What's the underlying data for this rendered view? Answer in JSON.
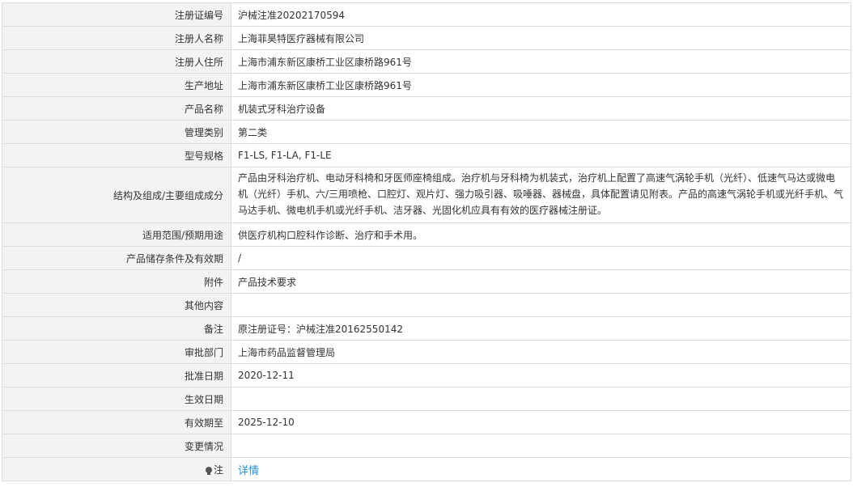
{
  "rows": [
    {
      "label": "注册证编号",
      "value": "沪械注准20202170594"
    },
    {
      "label": "注册人名称",
      "value": "上海菲昊特医疗器械有限公司"
    },
    {
      "label": "注册人住所",
      "value": "上海市浦东新区康桥工业区康桥路961号"
    },
    {
      "label": "生产地址",
      "value": "上海市浦东新区康桥工业区康桥路961号"
    },
    {
      "label": "产品名称",
      "value": "机装式牙科治疗设备"
    },
    {
      "label": "管理类别",
      "value": "第二类"
    },
    {
      "label": "型号规格",
      "value": "F1-LS, F1-LA, F1-LE"
    },
    {
      "label": "结构及组成/主要组成成分",
      "value": "产品由牙科治疗机、电动牙科椅和牙医师座椅组成。治疗机与牙科椅为机装式，治疗机上配置了高速气涡轮手机（光纤）、低速气马达或微电机（光纤）手机、六/三用喷枪、口腔灯、观片灯、强力吸引器、吸唾器、器械盘，具体配置请见附表。产品的高速气涡轮手机或光纤手机、气马达手机、微电机手机或光纤手机、洁牙器、光固化机应具有有效的医疗器械注册证。"
    },
    {
      "label": "适用范围/预期用途",
      "value": "供医疗机构口腔科作诊断、治疗和手术用。"
    },
    {
      "label": "产品储存条件及有效期",
      "value": "/"
    },
    {
      "label": "附件",
      "value": "产品技术要求"
    },
    {
      "label": "其他内容",
      "value": ""
    },
    {
      "label": "备注",
      "value": "原注册证号：沪械注准20162550142"
    },
    {
      "label": "审批部门",
      "value": "上海市药品监督管理局"
    },
    {
      "label": "批准日期",
      "value": "2020-12-11"
    },
    {
      "label": "生效日期",
      "value": ""
    },
    {
      "label": "有效期至",
      "value": "2025-12-10"
    },
    {
      "label": "变更情况",
      "value": ""
    }
  ],
  "note": {
    "label": "注",
    "icon": "lightbulb-icon",
    "link_text": "详情",
    "link_color": "#2a8fd6"
  }
}
